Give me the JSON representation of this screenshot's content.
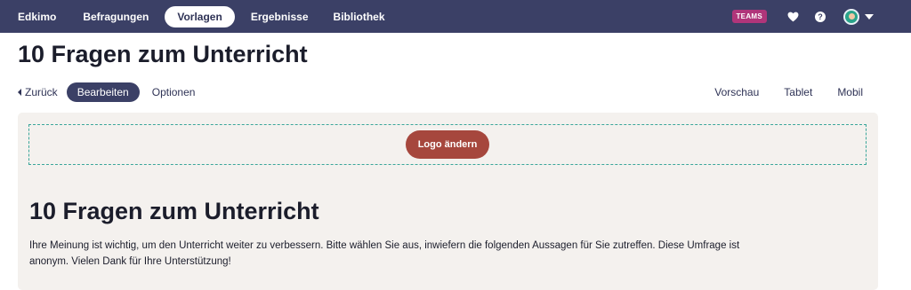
{
  "topnav": {
    "brand": "Edkimo",
    "items": [
      {
        "label": "Befragungen"
      },
      {
        "label": "Vorlagen"
      },
      {
        "label": "Ergebnisse"
      },
      {
        "label": "Bibliothek"
      }
    ],
    "active_item": "Vorlagen",
    "teams_badge": "TEAMS",
    "help_glyph": "?",
    "icons": [
      "heart-icon",
      "help-icon",
      "avatar",
      "chevron-down-icon"
    ]
  },
  "page": {
    "title": "10 Fragen zum Unterricht"
  },
  "toolbar": {
    "back_label": "Zurück",
    "edit_label": "Bearbeiten",
    "options_label": "Optionen",
    "preview_label": "Vorschau",
    "tablet_label": "Tablet",
    "mobile_label": "Mobil"
  },
  "canvas": {
    "logo_button_label": "Logo ändern",
    "survey_title": "10 Fragen zum Unterricht",
    "survey_intro": "Ihre Meinung ist wichtig, um den Unterricht weiter zu verbessern. Bitte wählen Sie aus, inwiefern die folgenden Aussagen für Sie zutreffen. Diese Umfrage ist anonym. Vielen Dank für Ihre Unterstützung!"
  },
  "colors": {
    "nav_background": "#3b4066",
    "teams_badge": "#b0357a",
    "logo_button": "#a6473d",
    "logo_zone_border": "#3aa69a",
    "canvas_background": "#f4f1ee"
  }
}
